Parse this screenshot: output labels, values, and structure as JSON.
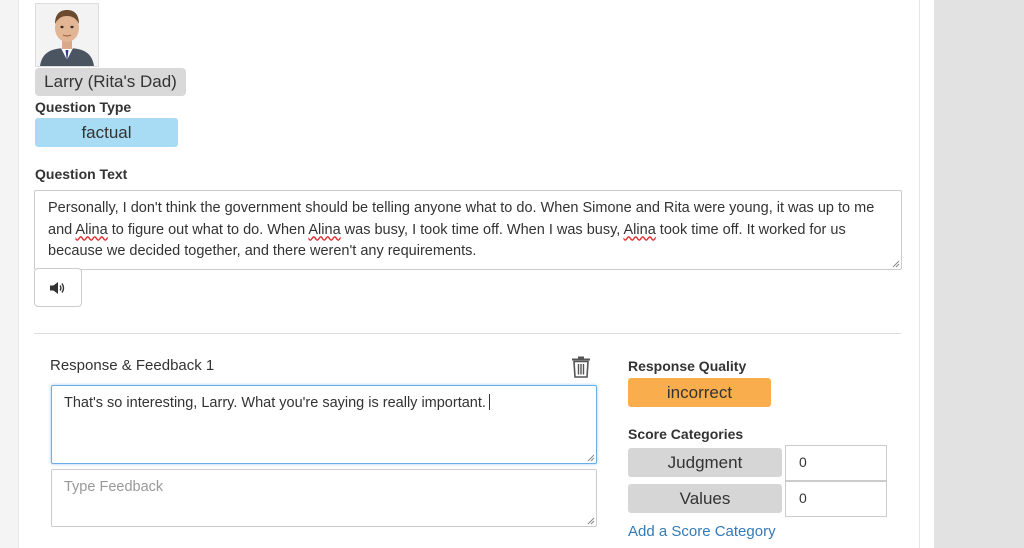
{
  "character": {
    "avatar_icon": "man-in-suit-portrait",
    "name": "Larry (Rita's Dad)"
  },
  "question_type": {
    "label": "Question Type",
    "value": "factual"
  },
  "question_text": {
    "label": "Question Text",
    "parts": [
      "Personally, I don't think the government should be telling anyone what to do. When Simone and Rita were young, it was up to me and ",
      "Alina",
      " to figure out what to do. When ",
      "Alina",
      " was busy, I took time off. When I was busy, ",
      "Alina",
      " took time off. It worked for us because we decided together, and there weren't any requirements."
    ],
    "speaker_icon": "volume-icon"
  },
  "response": {
    "title": "Response & Feedback 1",
    "delete_icon": "trash-icon",
    "value": "That's so interesting, Larry. What you're saying is really important.",
    "feedback_placeholder": "Type Feedback"
  },
  "quality": {
    "label": "Response Quality",
    "value": "incorrect"
  },
  "score_categories": {
    "label": "Score Categories",
    "items": [
      {
        "name": "Judgment",
        "score": "0"
      },
      {
        "name": "Values",
        "score": "0"
      }
    ],
    "add_link": "Add a Score Category"
  },
  "colors": {
    "question_type_chip": "#a8dcf4",
    "quality_chip": "#f9ad4d",
    "category_chip": "#d6d6d6",
    "link": "#337ab7",
    "focus_border": "#66afe9"
  }
}
